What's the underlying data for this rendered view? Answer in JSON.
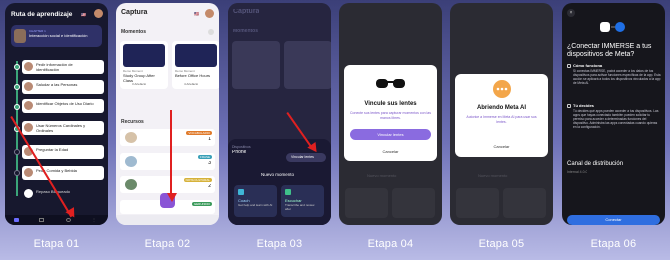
{
  "steps": [
    {
      "caption": "Etapa 01"
    },
    {
      "caption": "Etapa 02"
    },
    {
      "caption": "Etapa 03"
    },
    {
      "caption": "Etapa 04"
    },
    {
      "caption": "Etapa 05"
    },
    {
      "caption": "Etapa 06"
    }
  ],
  "colors": {
    "background_top": "#3b3f78",
    "background_bottom": "#b9bbe6",
    "arrow": "#e02020",
    "accent_purple": "#8a6be0",
    "progress_green": "#3ba57a"
  },
  "screen1": {
    "title": "Ruta de aprendizaje",
    "flag": "🇺🇸",
    "chapter_label": "CHAPTER 1",
    "chapter_title": "Interacción social e identificación",
    "items": [
      "Pedir información de identificación",
      "Saludar a las Personas",
      "Identificar Objetos de Uso Diario",
      "Usar Números Cardinales y Ordinales",
      "Preguntar la Edad",
      "Pedir Comida y Bebida",
      "Repaso Bloqueado"
    ]
  },
  "screen2": {
    "title": "Captura",
    "flag": "🇺🇸",
    "moments_heading": "Momentos",
    "moment_cards": [
      {
        "tag": "Demo Moment",
        "title": "Study Group After Class",
        "count": "3 Artefacto"
      },
      {
        "tag": "Demo Moment",
        "title": "Before Office Hours",
        "count": "4 Artefacto"
      }
    ],
    "resources_heading": "Recursos",
    "resources": [
      {
        "badge": "VOCABULARIO",
        "number": "1"
      },
      {
        "badge": "FRASE",
        "number": "3"
      },
      {
        "badge": "NOTA CULTURAL",
        "number": "2"
      },
      {
        "badge": "GERUNDIO",
        "number": ""
      }
    ]
  },
  "screen3": {
    "device_label": "Dispositivos",
    "device_name": "Phone",
    "link_button": "Vincular lentes",
    "sheet_title": "Nuevo momento",
    "options": [
      {
        "name": "Coach",
        "desc": "Get help and learn with AI"
      },
      {
        "name": "Escuchar",
        "desc": "Transcribe and review after"
      }
    ],
    "bg_title": "Captura",
    "bg_heading": "Momentos",
    "bg_cards": [
      "After the Call",
      "Before Office Hours"
    ]
  },
  "screen4": {
    "title": "Vincule sus lentes",
    "description": "Conecte sus lentes para capturar momentos con las manos libres.",
    "primary": "Vincular lentes",
    "secondary": "Cancelar",
    "bg_nuevo": "Nuevo momento"
  },
  "screen5": {
    "title": "Abriendo Meta AI",
    "description": "Autorice a Immerse en Meta AI para usar sus lentes.",
    "secondary": "Cancelar",
    "bg_nuevo": "Nuevo momento"
  },
  "screen6": {
    "title": "¿Conectar IMMERSE a tus dispositivos de Meta?",
    "sections": [
      {
        "heading": "Cómo funciona",
        "text": "Si conectas IMMERSE, podrá acceder a los datos de tus dispositivos para activar funciones específicas de la app. Esta acción se aplicará a todos los dispositivos vinculados a la app de Meta AI."
      },
      {
        "heading": "Tú decides",
        "text": "Tú decides qué apps pueden acceder a tus dispositivos. Las apps que hayas conectado también pueden solicitar tu permiso para acceder a determinadas funciones del dispositivo. Administra las apps conectadas cuando quieras en la configuración."
      }
    ],
    "channel_heading": "Canal de distribución",
    "channel_value": "Internal 4.0.0",
    "cta": "Conectar"
  }
}
